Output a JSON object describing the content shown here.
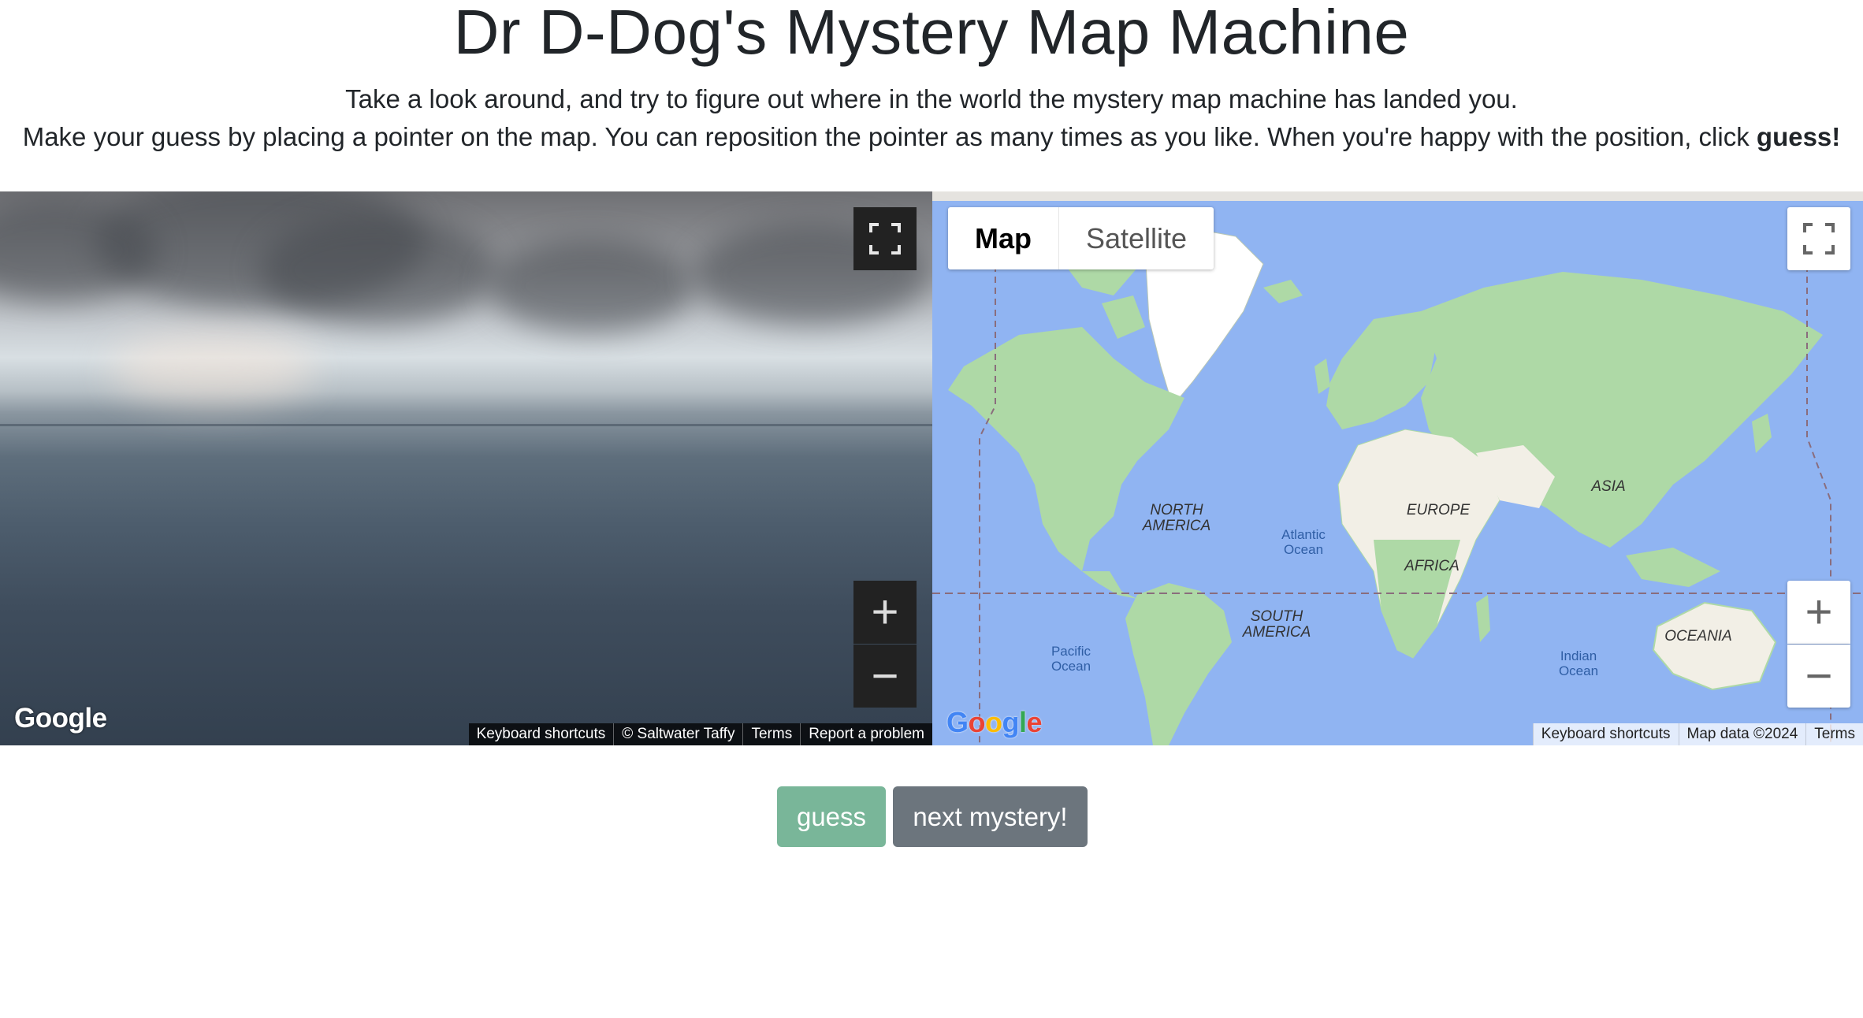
{
  "page": {
    "title": "Dr D-Dog's Mystery Map Machine",
    "intro_line1": "Take a look around, and try to figure out where in the world the mystery map machine has landed you.",
    "intro_line2": "Make your guess by placing a pointer on the map. You can reposition the pointer as many times as you like. When you're happy with the position, click",
    "intro_emphasis": "guess!"
  },
  "street_view": {
    "logo": "Google",
    "footer": [
      "Keyboard shortcuts",
      "© Saltwater Taffy",
      "Terms",
      "Report a problem"
    ],
    "icons": {
      "fullscreen": "fullscreen-icon",
      "zoom_in": "plus-icon",
      "zoom_out": "minus-icon"
    }
  },
  "map": {
    "type_tabs": [
      "Map",
      "Satellite"
    ],
    "selected_tab": "Map",
    "logo": "Google",
    "footer": [
      "Keyboard shortcuts",
      "Map data ©2024",
      "Terms"
    ],
    "labels": {
      "north_america_1": "NORTH",
      "north_america_2": "AMERICA",
      "south_america_1": "SOUTH",
      "south_america_2": "AMERICA",
      "europe": "EUROPE",
      "asia": "ASIA",
      "africa": "AFRICA",
      "oceania": "OCEANIA",
      "atlantic_1": "Atlantic",
      "atlantic_2": "Ocean",
      "pacific_1": "Pacific",
      "pacific_2": "Ocean",
      "indian_1": "Indian",
      "indian_2": "Ocean"
    },
    "colors": {
      "water": "#90b4f2",
      "land": "#aed9a6",
      "ice": "#ffffff",
      "desert": "#f2efe6"
    },
    "icons": {
      "fullscreen": "fullscreen-icon",
      "zoom_in": "plus-icon",
      "zoom_out": "minus-icon"
    }
  },
  "buttons": {
    "guess": "guess",
    "next": "next mystery!"
  },
  "colors": {
    "guess_button": "#79b699",
    "next_button": "#6c757d",
    "text": "#212529"
  }
}
